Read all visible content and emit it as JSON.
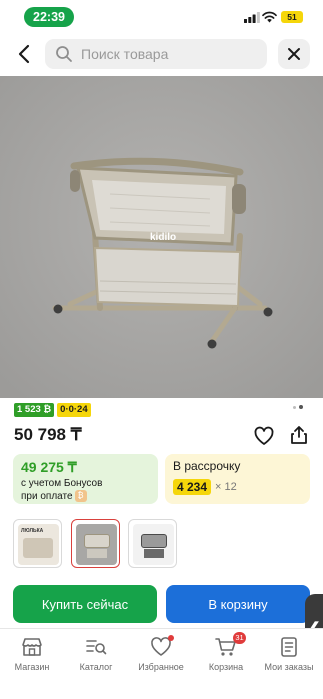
{
  "status_bar": {
    "time": "22:39",
    "battery": "51"
  },
  "search": {
    "placeholder": "Поиск товара"
  },
  "product": {
    "image_brand_text": "kidilo",
    "bonus_badge": "1 523 ₿",
    "installment_badge": "0·0·24",
    "price": "50 798 ₸",
    "bonus_card": {
      "price": "49 275 ₸",
      "caption_line1": "с учетом Бонусов",
      "caption_line2": "при оплате"
    },
    "installment_card": {
      "title": "В рассрочку",
      "amount": "4 234",
      "months": "× 12"
    },
    "thumbnails": [
      {
        "label": "ЛЮЛЬКА",
        "selected": false
      },
      {
        "label": "",
        "selected": true
      },
      {
        "label": "",
        "selected": false
      }
    ],
    "carousel": {
      "dots": 2,
      "active_index": 1
    }
  },
  "actions": {
    "buy_label": "Купить сейчас",
    "cart_label": "В корзину",
    "side_handle": "❮"
  },
  "bottom_nav": {
    "items": [
      {
        "label": "Магазин",
        "icon": "store-icon"
      },
      {
        "label": "Каталог",
        "icon": "catalog-icon"
      },
      {
        "label": "Избранное",
        "icon": "heart-icon"
      },
      {
        "label": "Корзина",
        "icon": "cart-icon",
        "badge": "31"
      },
      {
        "label": "Мои заказы",
        "icon": "orders-icon"
      }
    ]
  },
  "colors": {
    "primary_green": "#16a34a",
    "primary_blue": "#1c6fd9",
    "bonus_green": "#2f9e27",
    "installment_yellow": "#f5d60a",
    "alert_red": "#e03b3b"
  }
}
